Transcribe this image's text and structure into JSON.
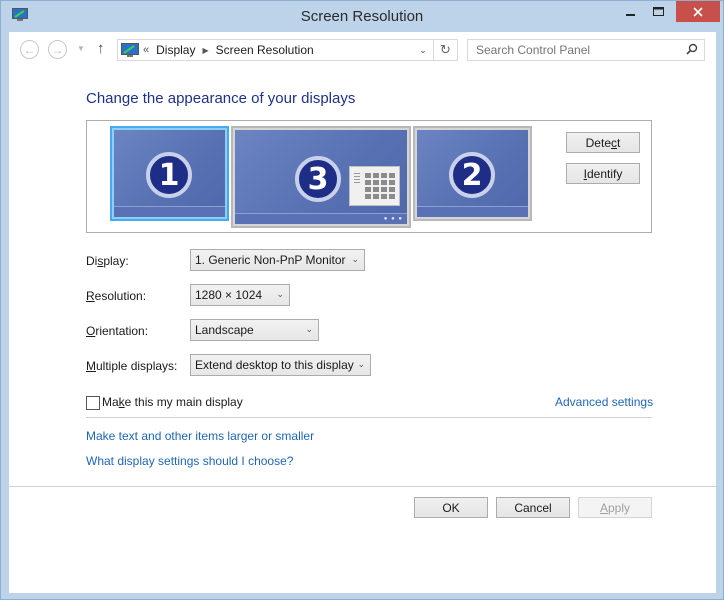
{
  "window": {
    "title": "Screen Resolution",
    "icons": {
      "app": "display-settings-icon",
      "minimize": "minimize-icon",
      "maximize": "maximize-icon",
      "close": "close-icon"
    }
  },
  "navbar": {
    "back_icon": "←",
    "forward_icon": "→",
    "recent_icon": "▼",
    "up_icon": "↑",
    "address": {
      "overflow": "«",
      "breadcrumbs": [
        "Display",
        "Screen Resolution"
      ],
      "dropdown_icon": "⌄",
      "refresh_icon": "↻"
    },
    "search": {
      "placeholder": "Search Control Panel",
      "value": "",
      "icon": "⚲"
    }
  },
  "main": {
    "heading": "Change the appearance of your displays",
    "monitors": [
      {
        "number": "1",
        "selected": true
      },
      {
        "number": "3",
        "selected": false,
        "primary": true
      },
      {
        "number": "2",
        "selected": false
      }
    ],
    "detect_label": {
      "pre": "Dete",
      "key": "c",
      "post": "t"
    },
    "identify_label": {
      "pre": "",
      "key": "I",
      "post": "dentify"
    },
    "fields": {
      "display": {
        "label_pre": "Di",
        "label_key": "s",
        "label_post": "play:",
        "value": "1. Generic Non-PnP Monitor"
      },
      "resolution": {
        "label_pre": "",
        "label_key": "R",
        "label_post": "esolution:",
        "value": "1280 × 1024"
      },
      "orientation": {
        "label_pre": "",
        "label_key": "O",
        "label_post": "rientation:",
        "value": "Landscape"
      },
      "multiple": {
        "label_pre": "",
        "label_key": "M",
        "label_post": "ultiple displays:",
        "value": "Extend desktop to this display"
      }
    },
    "main_display": {
      "label_pre": "Ma",
      "label_key": "k",
      "label_post": "e this my main display",
      "checked": false
    },
    "advanced_link": "Advanced settings",
    "links": [
      "Make text and other items larger or smaller",
      "What display settings should I choose?"
    ]
  },
  "footer": {
    "ok_label": "OK",
    "cancel_label": "Cancel",
    "apply_label": {
      "key": "A",
      "post": "pply"
    },
    "apply_enabled": false
  }
}
